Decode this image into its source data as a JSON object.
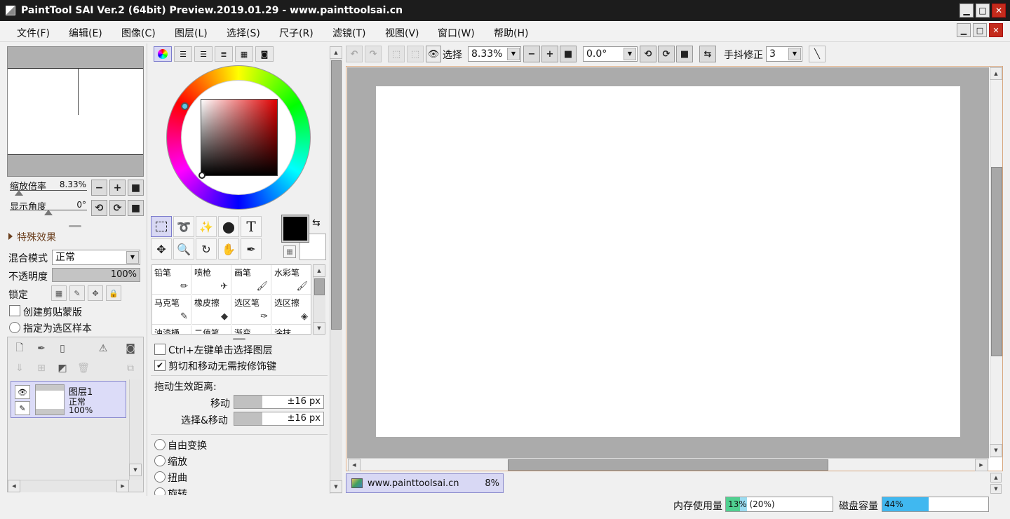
{
  "window": {
    "title": "PaintTool SAI Ver.2 (64bit) Preview.2019.01.29 - www.painttoolsai.cn",
    "minimize": "▁",
    "maximize": "□",
    "close": "✕"
  },
  "menu": [
    "文件(F)",
    "编辑(E)",
    "图像(C)",
    "图层(L)",
    "选择(S)",
    "尺子(R)",
    "滤镜(T)",
    "视图(V)",
    "窗口(W)",
    "帮助(H)"
  ],
  "navigator": {
    "zoom_label": "缩放倍率",
    "zoom_value": "8.33%",
    "zoom_fraction": 0.12,
    "angle_label": "显示角度",
    "angle_value": "0°",
    "angle_fraction": 0.5
  },
  "effects": {
    "header": "特殊效果"
  },
  "layer_props": {
    "blend_label": "混合模式",
    "blend_value": "正常",
    "opacity_label": "不透明度",
    "opacity_value": "100%",
    "opacity_fraction": 1.0,
    "lock_label": "锁定",
    "clip_label": "创建剪贴蒙版",
    "sample_label": "指定为选区样本"
  },
  "layer": {
    "name": "图层1",
    "mode": "正常",
    "opacity": "100%"
  },
  "tools": {
    "text_tool": "T"
  },
  "colors": {
    "foreground": "#000000",
    "background": "#ffffff",
    "accent": "#d8d8f4",
    "memory_fill": "#50d090",
    "disk_fill": "#40b8f0"
  },
  "brushes": [
    {
      "name": "铅笔",
      "icon": "pencil-icon"
    },
    {
      "name": "喷枪",
      "icon": "airbrush-icon"
    },
    {
      "name": "画笔",
      "icon": "brush-icon"
    },
    {
      "name": "水彩笔",
      "icon": "watercolor-icon"
    },
    {
      "name": "马克笔",
      "icon": "marker-icon"
    },
    {
      "name": "橡皮擦",
      "icon": "eraser-icon"
    },
    {
      "name": "选区笔",
      "icon": "selection-pen-icon"
    },
    {
      "name": "选区擦",
      "icon": "selection-eraser-icon"
    },
    {
      "name": "油漆桶",
      "icon": "bucket-icon"
    },
    {
      "name": "二值笔",
      "icon": "binary-pen-icon"
    },
    {
      "name": "渐变",
      "icon": "gradient-icon"
    },
    {
      "name": "涂抹",
      "icon": "smudge-icon"
    }
  ],
  "tool_options": {
    "ctrl_click": "Ctrl+左键单击选择图层",
    "cut_move": "剪切和移动无需按修饰键",
    "drag_distance": "拖动生效距离:",
    "move_label": "移动",
    "move_value": "±16 px",
    "select_move_label": "选择&移动",
    "select_move_value": "±16 px",
    "transforms": [
      "自由变换",
      "缩放",
      "扭曲",
      "旋转"
    ]
  },
  "toolbar": {
    "select_label": "选择",
    "zoom_value": "8.33%",
    "angle_value": "0.0°",
    "stabilizer_label": "手抖修正",
    "stabilizer_value": "3"
  },
  "document": {
    "name": "www.painttoolsai.cn",
    "zoom": "8%"
  },
  "status": {
    "memory_label": "内存使用量",
    "memory_value": "13% (20%)",
    "memory_fraction": 0.13,
    "memory_peak_fraction": 0.2,
    "disk_label": "磁盘容量",
    "disk_value": "44%",
    "disk_fraction": 0.44
  }
}
